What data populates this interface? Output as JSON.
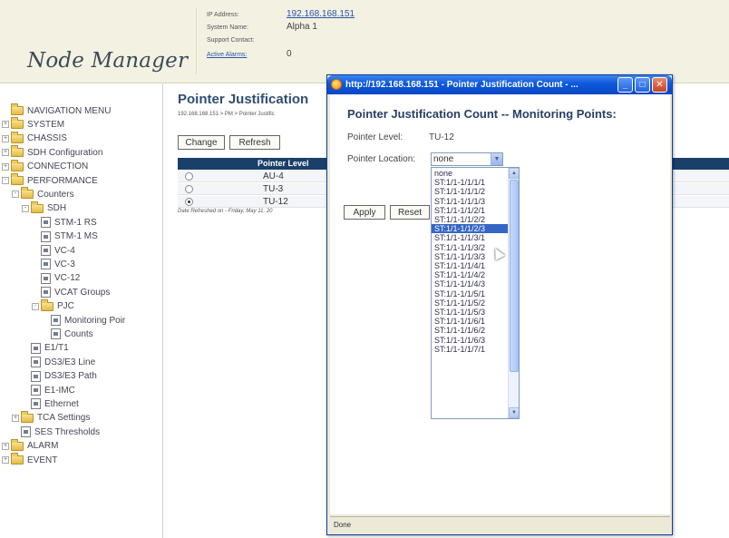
{
  "header": {
    "app_title": "Node Manager",
    "fields": [
      {
        "label": "IP Address:",
        "value": "192.168.168.151",
        "is_link": true
      },
      {
        "label": "System Name:",
        "value": "Alpha 1",
        "is_link": false
      },
      {
        "label": "Support Contact:",
        "value": "",
        "is_link": false
      },
      {
        "label": "Active Alarms:",
        "value": "0",
        "is_link": false
      }
    ]
  },
  "nav": {
    "items": [
      {
        "label": "NAVIGATION MENU",
        "depth": 0,
        "icon": "folder-icon",
        "expander": ""
      },
      {
        "label": "SYSTEM",
        "depth": 0,
        "icon": "folder-icon",
        "expander": "+"
      },
      {
        "label": "CHASSIS",
        "depth": 0,
        "icon": "folder-icon",
        "expander": "+"
      },
      {
        "label": "SDH Configuration",
        "depth": 0,
        "icon": "folder-icon",
        "expander": "+"
      },
      {
        "label": "CONNECTION",
        "depth": 0,
        "icon": "folder-icon",
        "expander": "+"
      },
      {
        "label": "PERFORMANCE",
        "depth": 0,
        "icon": "folder-icon",
        "expander": "-"
      },
      {
        "label": "Counters",
        "depth": 1,
        "icon": "folder-icon",
        "expander": "-"
      },
      {
        "label": "SDH",
        "depth": 2,
        "icon": "folder-icon",
        "expander": "-"
      },
      {
        "label": "STM-1 RS",
        "depth": 3,
        "icon": "doc-icon",
        "expander": ""
      },
      {
        "label": "STM-1 MS",
        "depth": 3,
        "icon": "doc-icon",
        "expander": ""
      },
      {
        "label": "VC-4",
        "depth": 3,
        "icon": "doc-icon",
        "expander": ""
      },
      {
        "label": "VC-3",
        "depth": 3,
        "icon": "doc-icon",
        "expander": ""
      },
      {
        "label": "VC-12",
        "depth": 3,
        "icon": "doc-icon",
        "expander": ""
      },
      {
        "label": "VCAT Groups",
        "depth": 3,
        "icon": "doc-icon",
        "expander": ""
      },
      {
        "label": "PJC",
        "depth": 3,
        "icon": "folder-icon",
        "expander": "-"
      },
      {
        "label": "Monitoring Poir",
        "depth": 4,
        "icon": "doc-icon",
        "expander": ""
      },
      {
        "label": "Counts",
        "depth": 4,
        "icon": "doc-icon",
        "expander": ""
      },
      {
        "label": "E1/T1",
        "depth": 2,
        "icon": "doc-icon",
        "expander": ""
      },
      {
        "label": "DS3/E3 Line",
        "depth": 2,
        "icon": "doc-icon",
        "expander": ""
      },
      {
        "label": "DS3/E3 Path",
        "depth": 2,
        "icon": "doc-icon",
        "expander": ""
      },
      {
        "label": "E1-IMC",
        "depth": 2,
        "icon": "doc-icon",
        "expander": ""
      },
      {
        "label": "Ethernet",
        "depth": 2,
        "icon": "doc-icon",
        "expander": ""
      },
      {
        "label": "TCA Settings",
        "depth": 1,
        "icon": "folder-icon",
        "expander": "+"
      },
      {
        "label": "SES Thresholds",
        "depth": 1,
        "icon": "doc-icon",
        "expander": ""
      },
      {
        "label": "ALARM",
        "depth": 0,
        "icon": "folder-icon",
        "expander": "+"
      },
      {
        "label": "EVENT",
        "depth": 0,
        "icon": "folder-icon",
        "expander": "+"
      }
    ]
  },
  "main": {
    "title": "Pointer Justification",
    "breadcrumb": "192.168.168.151 > PM > Pointer Justific",
    "change_label": "Change",
    "refresh_label": "Refresh",
    "table": {
      "header": "Pointer Level",
      "rows": [
        {
          "level": "AU-4",
          "selected": false
        },
        {
          "level": "TU-3",
          "selected": false
        },
        {
          "level": "TU-12",
          "selected": true
        }
      ]
    },
    "date_refreshed": "Date Refreshed on - Friday, May 11, 20"
  },
  "popup": {
    "window_title": "http://192.168.168.151 - Pointer Justification Count - ...",
    "heading": "Pointer Justification Count -- Monitoring Points:",
    "level_label": "Pointer Level:",
    "level_value": "TU-12",
    "location_label": "Pointer Location:",
    "location_value": "none",
    "options": [
      "none",
      "ST:1/1-1/1/1/1",
      "ST:1/1-1/1/1/2",
      "ST:1/1-1/1/1/3",
      "ST:1/1-1/1/2/1",
      "ST:1/1-1/1/2/2",
      "ST:1/1-1/1/2/3",
      "ST:1/1-1/1/3/1",
      "ST:1/1-1/1/3/2",
      "ST:1/1-1/1/3/3",
      "ST:1/1-1/1/4/1",
      "ST:1/1-1/1/4/2",
      "ST:1/1-1/1/4/3",
      "ST:1/1-1/1/5/1",
      "ST:1/1-1/1/5/2",
      "ST:1/1-1/1/5/3",
      "ST:1/1-1/1/6/1",
      "ST:1/1-1/1/6/2",
      "ST:1/1-1/1/6/3",
      "ST:1/1-1/1/7/1"
    ],
    "highlighted_option": "ST:1/1-1/1/2/3",
    "apply_label": "Apply",
    "reset_label": "Reset",
    "status_text": "Done"
  },
  "colors": {
    "header_bg": "#f3f1e2",
    "title_text": "#304e70",
    "table_header_bg": "#1a3f6a",
    "titlebar_blue": "#0d58dc",
    "selection_blue": "#3566c4"
  }
}
